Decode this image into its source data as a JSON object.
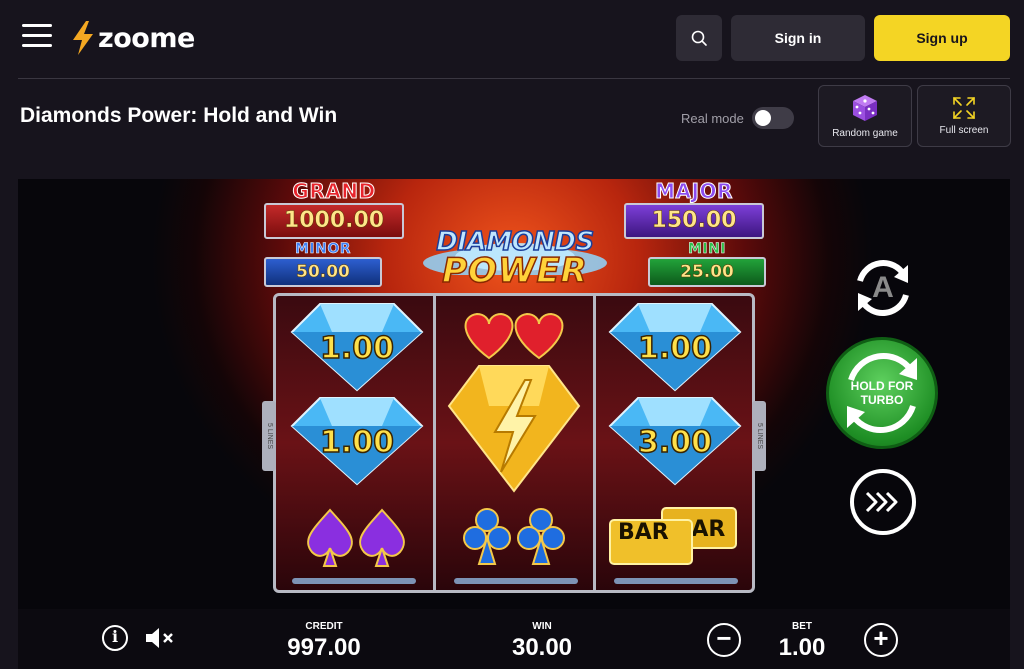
{
  "header": {
    "logo_text": "zoome",
    "signin_label": "Sign in",
    "signup_label": "Sign up"
  },
  "title_row": {
    "page_title": "Diamonds Power: Hold and Win",
    "realmode_label": "Real mode",
    "realmode_on": false,
    "random_game_label": "Random game",
    "fullscreen_label": "Full screen"
  },
  "game": {
    "logo_line1": "DIAMONDS",
    "logo_line2": "POWER",
    "jackpots": {
      "grand": {
        "label": "GRAND",
        "value": "1000.00"
      },
      "major": {
        "label": "MAJOR",
        "value": "150.00"
      },
      "minor": {
        "label": "MINOR",
        "value": "50.00"
      },
      "mini": {
        "label": "MINI",
        "value": "25.00"
      }
    },
    "lines_label": "5 LINES",
    "reels": [
      [
        "1.00",
        "1.00",
        "spades"
      ],
      [
        "hearts",
        "bolt",
        "clubs"
      ],
      [
        "1.00",
        "3.00",
        "bar"
      ]
    ],
    "cells": {
      "r1c1": "1.00",
      "r1c2": "1.00",
      "r3c1": "1.00",
      "r3c2": "3.00",
      "bar": "BAR"
    },
    "turbo_label": "HOLD FOR TURBO",
    "auto_label": "A"
  },
  "bottom_bar": {
    "credit_label": "CREDIT",
    "credit_value": "997.00",
    "win_label": "WIN",
    "win_value": "30.00",
    "bet_label": "BET",
    "bet_value": "1.00"
  },
  "colors": {
    "accent": "#f4d524",
    "background": "#17141d",
    "button_dark": "#2e2b35"
  }
}
